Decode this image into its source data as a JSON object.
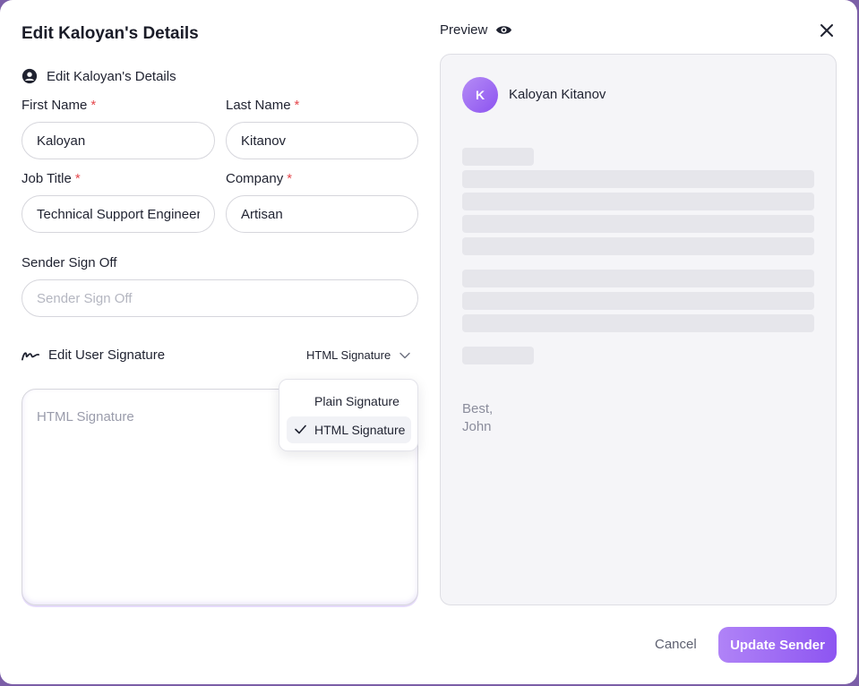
{
  "modal": {
    "title": "Edit Kaloyan's Details",
    "section_title": "Edit Kaloyan's Details"
  },
  "form": {
    "first_name_label": "First Name",
    "first_name_value": "Kaloyan",
    "last_name_label": "Last Name",
    "last_name_value": "Kitanov",
    "job_title_label": "Job Title",
    "job_title_value": "Technical Support Engineer",
    "company_label": "Company",
    "company_value": "Artisan",
    "required_marker": "*",
    "sign_off_label": "Sender Sign Off",
    "sign_off_placeholder": "Sender Sign Off",
    "sign_off_value": ""
  },
  "signature": {
    "section_title": "Edit User Signature",
    "selected_type": "HTML Signature",
    "placeholder": "HTML Signature",
    "options": [
      "Plain Signature",
      "HTML Signature"
    ]
  },
  "preview": {
    "label": "Preview",
    "avatar_initial": "K",
    "sender_name": "Kaloyan Kitanov",
    "sign_off_line1": "Best,",
    "sign_off_line2": "John"
  },
  "footer": {
    "cancel_label": "Cancel",
    "update_label": "Update Sender"
  },
  "colors": {
    "accent": "#8d55f1",
    "required": "#e5484d",
    "preview_bg": "#f5f5f8"
  },
  "icons": {
    "section": "user-circle-icon",
    "signature": "signature-icon",
    "dropdown": "chevron-down-icon",
    "selected": "check-icon",
    "preview": "eye-icon",
    "close": "close-icon"
  }
}
